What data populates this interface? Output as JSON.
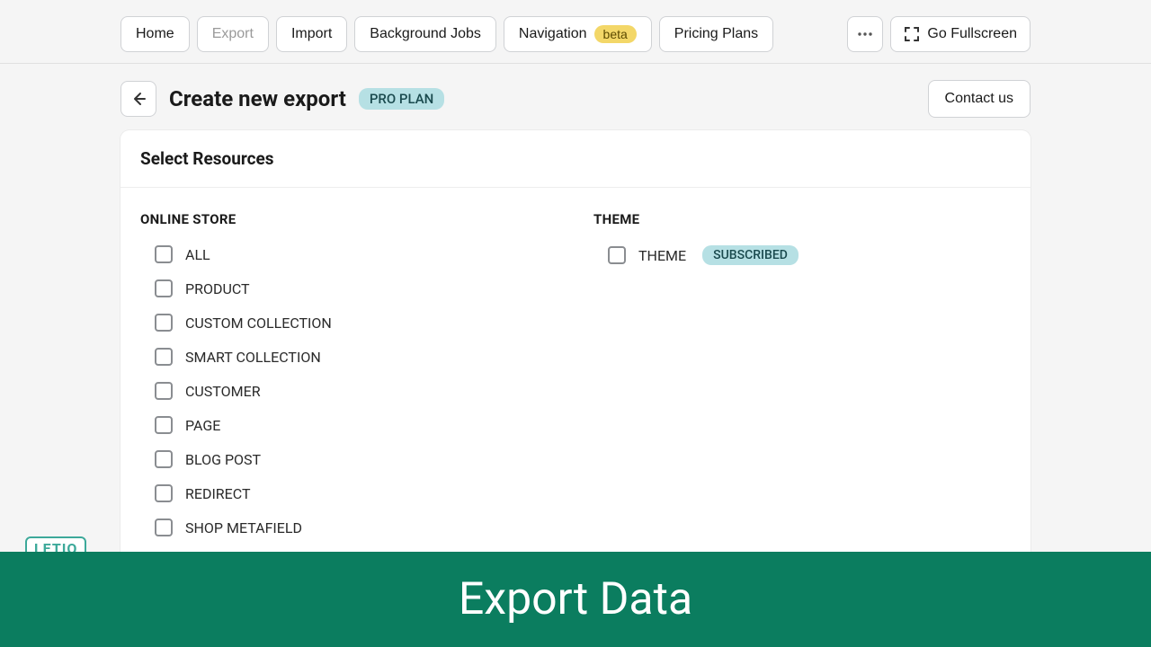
{
  "nav": {
    "home": "Home",
    "export": "Export",
    "import": "Import",
    "background_jobs": "Background Jobs",
    "navigation": "Navigation",
    "navigation_badge": "beta",
    "pricing": "Pricing Plans",
    "fullscreen": "Go Fullscreen"
  },
  "header": {
    "title": "Create new export",
    "plan_badge": "PRO PLAN",
    "contact": "Contact us"
  },
  "card": {
    "title": "Select Resources",
    "online_store": {
      "heading": "ONLINE STORE",
      "items": [
        {
          "label": "ALL"
        },
        {
          "label": "PRODUCT"
        },
        {
          "label": "CUSTOM COLLECTION"
        },
        {
          "label": "SMART COLLECTION"
        },
        {
          "label": "CUSTOMER"
        },
        {
          "label": "PAGE"
        },
        {
          "label": "BLOG POST"
        },
        {
          "label": "REDIRECT"
        },
        {
          "label": "SHOP METAFIELD"
        }
      ]
    },
    "theme": {
      "heading": "THEME",
      "items": [
        {
          "label": "THEME",
          "badge": "SUBSCRIBED"
        }
      ]
    }
  },
  "banner": {
    "text": "Export Data"
  },
  "watermark": "LETIO"
}
